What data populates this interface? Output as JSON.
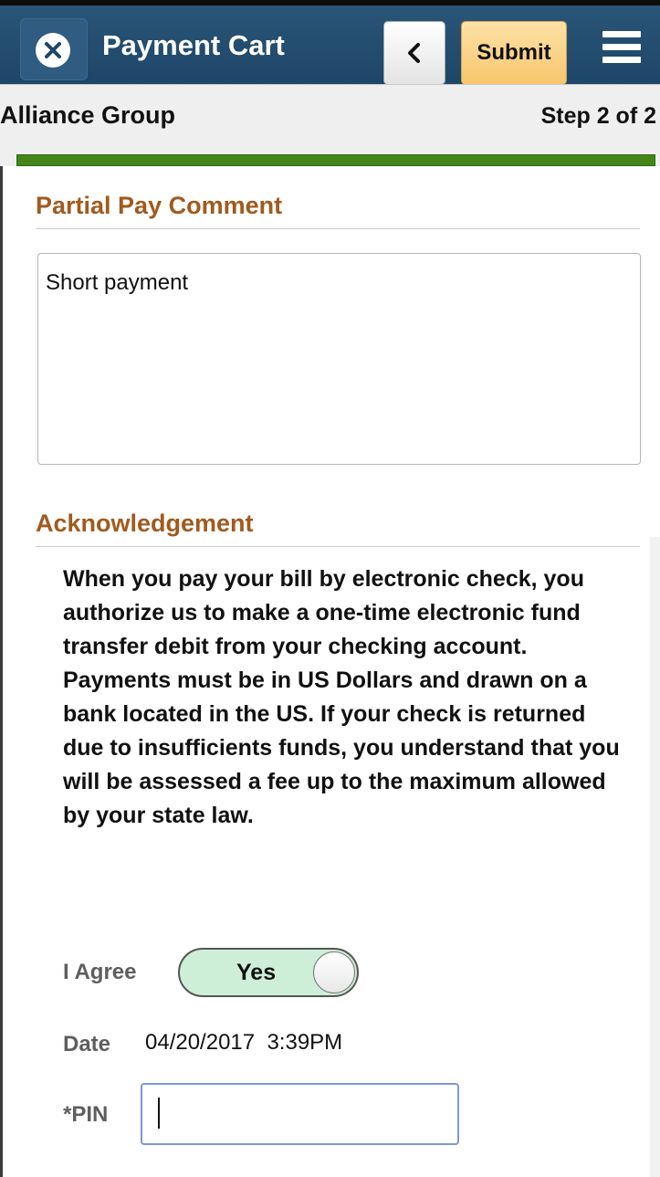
{
  "header": {
    "title": "Payment Cart",
    "submit_label": "Submit",
    "back_icon": "chevron-left-icon",
    "close_icon": "close-icon",
    "menu_icon": "hamburger-menu-icon"
  },
  "subheader": {
    "company": "Alliance Group",
    "step": "Step 2 of 2",
    "progress": 1.0
  },
  "partial_pay": {
    "title": "Partial Pay Comment",
    "comment": "Short payment"
  },
  "acknowledgement": {
    "title": "Acknowledgement",
    "text": "When you pay your bill by electronic check, you authorize us to make a one-time electronic fund transfer debit from your checking account. Payments must be in US Dollars and drawn on a bank located in the US. If your check is returned due to insufficients funds, you understand that you will be assessed a fee up to the maximum allowed by your state law.",
    "agree_label": "I Agree",
    "agree_value": "Yes",
    "date_label": "Date",
    "date_value": "04/20/2017  3:39PM",
    "pin_label": "*PIN",
    "pin_value": ""
  },
  "colors": {
    "topbar": "#1d4668",
    "section_title": "#a15a1e",
    "progress": "#458418",
    "submit": "#f8c66d",
    "toggle_on": "#cdeed7"
  }
}
